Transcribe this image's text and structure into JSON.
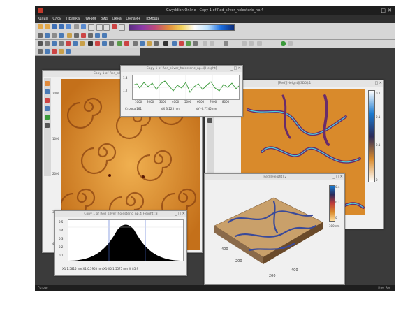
{
  "app": {
    "title": "Gwyddion Online - Copy 1 of Red_silver_holesteric_np.4",
    "window_controls": [
      "_",
      "□",
      "✕"
    ]
  },
  "menu": [
    "Файл",
    "Слой",
    "Правка",
    "Линия",
    "Вид",
    "Окна",
    "Онлайн",
    "Помощь"
  ],
  "windows": {
    "main_image": {
      "title": "Copy 1 of Red_silver_holesteric_np.4"
    },
    "profile": {
      "title": "Copy 1 of Red_silver_holesteric_np.4[Height]",
      "x_ticks": [
        "1000",
        "2000",
        "3000",
        "4000",
        "5000",
        "6000",
        "7000",
        "8000"
      ],
      "y_ticks": [
        "1.4",
        "1.2"
      ],
      "readout_1": "Строка  161",
      "readout_2": "dX  3.225 nm",
      "readout_3": "dY  -0.7745 nm"
    },
    "right_image": {
      "title": "[Red][Height][3D0]:1",
      "scale_ticks": [
        "0.2",
        "0.1",
        "0.1",
        "0"
      ]
    },
    "view3d": {
      "title": "[Red][Height]:2",
      "scale_ticks": [
        "0.4",
        "0.2",
        "0"
      ],
      "scale_unit": "300 nm",
      "axis_ticks": [
        "400",
        "200",
        "400",
        "200"
      ]
    },
    "histogram": {
      "title": "Copy 1 of Red_silver_holesteric_np.4[Height]:3",
      "y_ticks": [
        "0.5",
        "0.4",
        "0.3",
        "0.2",
        "0.1"
      ],
      "readout": "X1  1.5815 nm    X1  0.5903 nm    X1-X0  1.5575 nm  %  85.9"
    },
    "left_axis": [
      "2000",
      "1000",
      "2000",
      "3000",
      "4000"
    ]
  },
  "statusbar": {
    "left": "Готово",
    "right": "Free_Res"
  },
  "colors": {
    "titlebar": "#1e1e1e",
    "workspace": "#3b3b3b",
    "afm_orange": "#d98a2b"
  }
}
